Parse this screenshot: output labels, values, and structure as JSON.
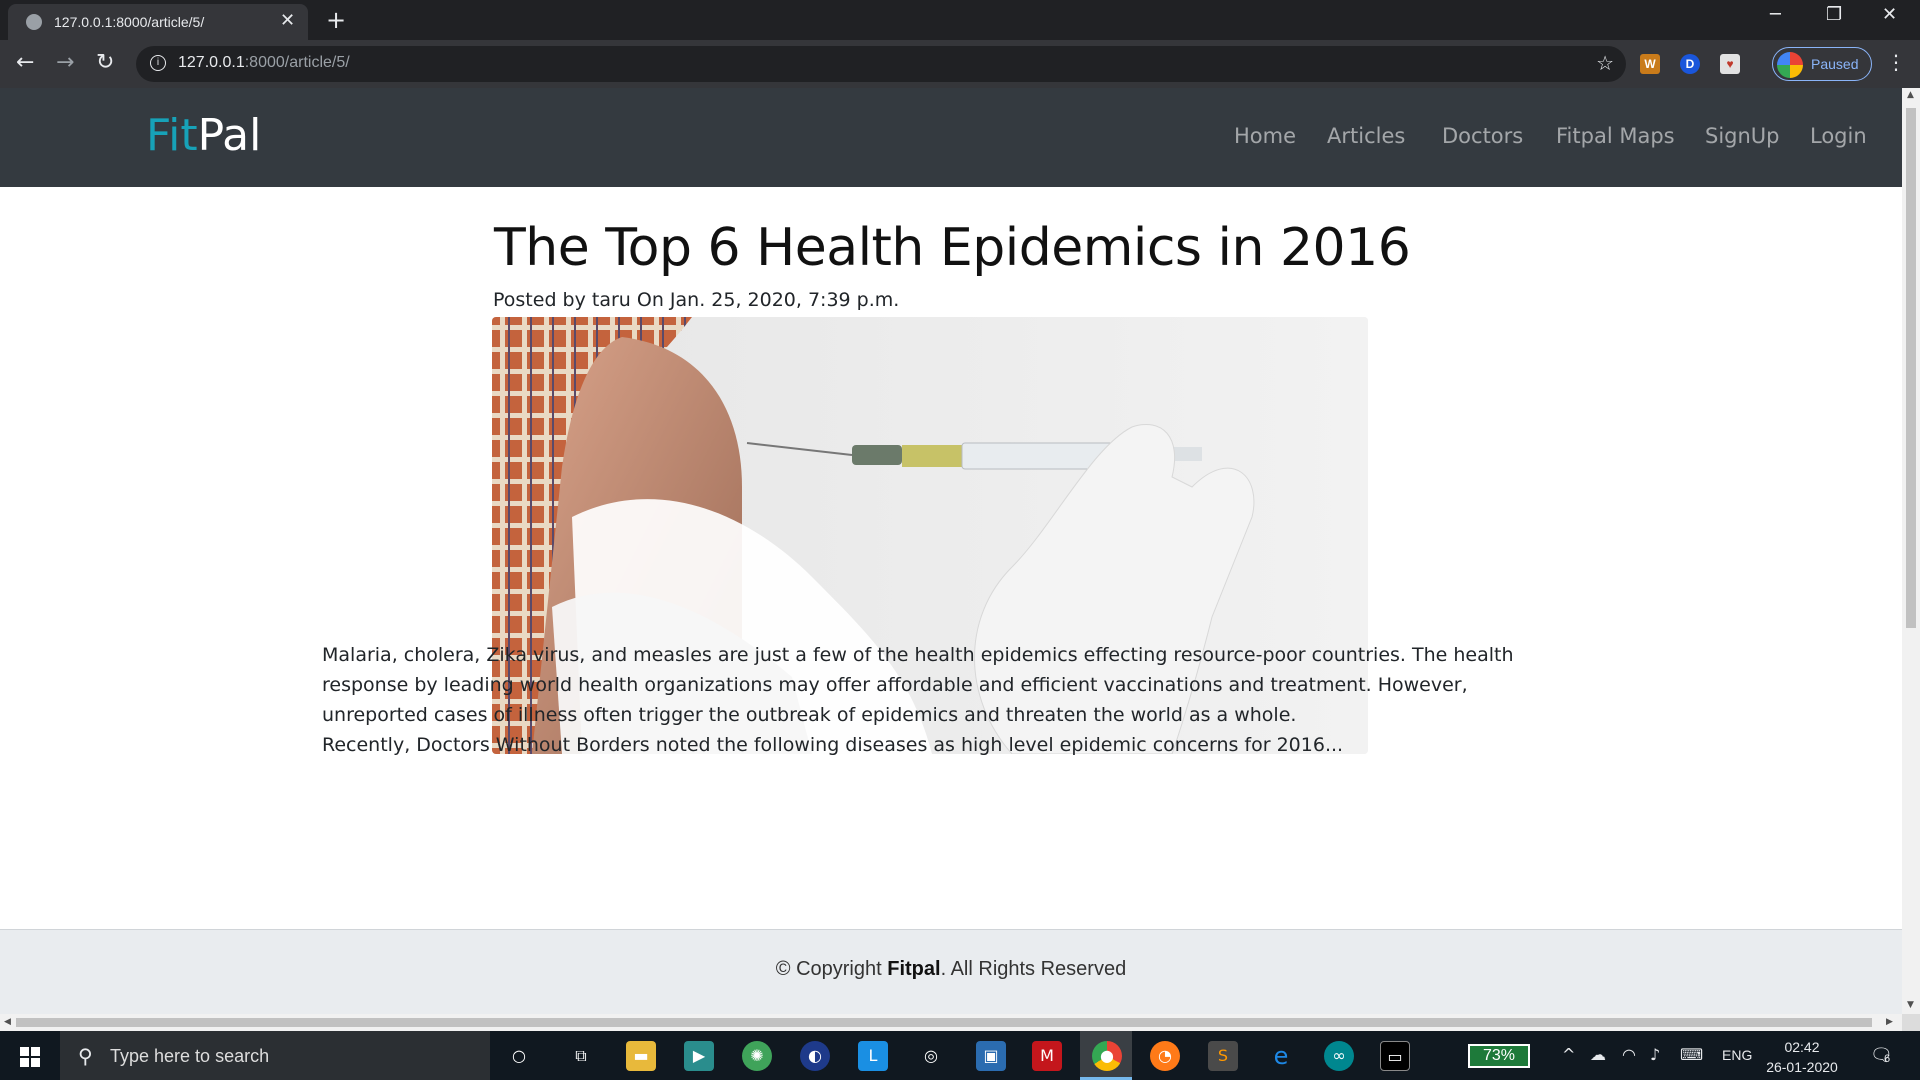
{
  "browser": {
    "tab_title": "127.0.0.1:8000/article/5/",
    "url_host": "127.0.0.1",
    "url_path": ":8000/article/5/",
    "profile_label": "Paused"
  },
  "site": {
    "brand_fit": "Fit",
    "brand_pal": "Pal",
    "nav": [
      "Home",
      "Articles",
      "Doctors",
      "Fitpal Maps",
      "SignUp",
      "Login"
    ]
  },
  "article": {
    "title": "The Top 6 Health Epidemics in 2016",
    "meta": "Posted by taru On Jan. 25, 2020, 7:39 p.m.",
    "paragraphs": [
      "Malaria, cholera, Zika virus, and measles are just a few of the health epidemics effecting resource-poor countries. The health response by leading world health organizations may offer affordable and efficient vaccinations and treatment. However, unreported cases of illness often trigger the outbreak of epidemics and threaten the world as a whole.",
      "Recently, Doctors Without Borders noted the following diseases as high level epidemic concerns for 2016..."
    ],
    "image_icon": "syringe-vaccination-photo"
  },
  "footer": {
    "prefix": "© Copyright ",
    "brand": "Fitpal",
    "suffix": ". All Rights Reserved"
  },
  "taskbar": {
    "search_placeholder": "Type here to search",
    "battery": "73%",
    "language": "ENG",
    "time": "02:42",
    "date": "26-01-2020",
    "notifications": "6"
  },
  "colors": {
    "navbar_bg": "#343a40",
    "brand_fit": "#17a2b8",
    "footer_bg": "#e9ecef"
  }
}
